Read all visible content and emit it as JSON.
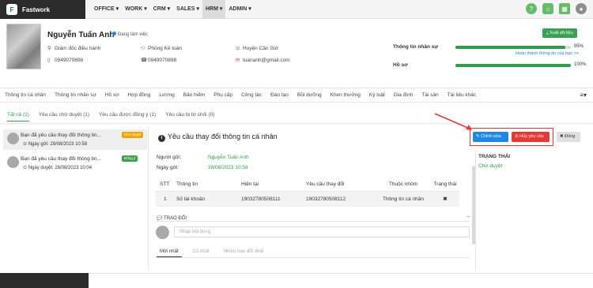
{
  "app": {
    "name": "Fastwork",
    "logo_text": "F"
  },
  "nav": {
    "items": [
      "OFFICE ▾",
      "WORK ▾",
      "CRM ▾",
      "SALES ▾",
      "HRM ▾",
      "ADMIN ▾"
    ],
    "active_index": 4
  },
  "top_icons": [
    {
      "name": "help-icon",
      "glyph": "?",
      "color": "#66bb6a"
    },
    {
      "name": "home-icon",
      "glyph": "⌂",
      "color": "#66bb6a"
    },
    {
      "name": "apps-grid-icon",
      "glyph": "▦",
      "color": "#66bb6a"
    },
    {
      "name": "user-avatar-icon",
      "glyph": "●",
      "color": "#8d8d8d"
    }
  ],
  "profile": {
    "name": "Nguyễn Tuấn Anh",
    "status": "Đang làm việc",
    "position": "Giám đốc điều hành",
    "department": "Phòng Kế toán",
    "location": "Huyện Cần Giờ",
    "phone1": "0949070898",
    "phone2": "0949070898",
    "email": "tuananh@gmail.com",
    "export_label": "Xuất dữ liệu",
    "complete_link": "Hoàn thành thông tin của bạn >>",
    "stats": [
      {
        "label": "Thông tin nhân sự",
        "pct_text": "95%",
        "fraction": 0.95
      },
      {
        "label": "Hồ sơ",
        "pct_text": "100%",
        "fraction": 1.0
      }
    ]
  },
  "tabs": [
    "Thông tin cá nhân",
    "Thông tin nhân sự",
    "Hồ sơ",
    "Hợp đồng",
    "Lương",
    "Bảo hiểm",
    "Phụ cấp",
    "Công tác",
    "Đào tạo",
    "Bồi dưỡng",
    "Khen thưởng",
    "Kỷ luật",
    "Gia đình",
    "Tài sản",
    "Tài liệu khác"
  ],
  "tabs_menu": "≡▾",
  "subtabs": [
    "Tất cả (2)",
    "Yêu cầu chờ duyệt (1)",
    "Yêu cầu được đồng ý (1)",
    "Yêu cầu bị từ chối (0)"
  ],
  "requests": [
    {
      "title": "Bạn đã yêu cầu thay đổi thông tin...",
      "date": "⊙ Ngày gửi: 28/08/2023 10:58",
      "badge": "Chờ duyệt",
      "badge_color": "#f0a500"
    },
    {
      "title": "Bạn đã yêu cầu thay đổi thông tin...",
      "date": "⊙ Ngày duyệt: 28/08/2023 10:04",
      "badge": "Đồng ý",
      "badge_color": "#43a047"
    }
  ],
  "detail": {
    "title": "Yêu cầu thay đổi thông tin cá nhân",
    "sender_label": "Người gửi:",
    "sender": "Nguyễn Tuấn Anh",
    "date_label": "Ngày gửi:",
    "date": "28/08/2023 10:58",
    "table": {
      "headers": [
        "STT",
        "Thông tin",
        "Hiện tại",
        "Yêu cầu thay đổi",
        "Thuộc nhóm",
        "Trạng thái"
      ],
      "rows": [
        [
          "1",
          "Số tài khoản",
          "19032780508111",
          "19032780508112",
          "Thông tin cá nhân",
          "✖"
        ]
      ]
    },
    "exchange_label": "TRAO ĐỔI",
    "comment_placeholder": "Nhập nội dung",
    "comment_tabs": [
      "Mới nhất",
      "Cũ nhất",
      "Nhiều trao đổi nhất"
    ]
  },
  "actions": {
    "edit": "✎ Chỉnh sửa",
    "cancel": "⊘ Hủy yêu cầu",
    "close": "✖ Đóng"
  },
  "status_panel": {
    "label": "TRẠNG THÁI",
    "value": "Chờ duyệt"
  }
}
